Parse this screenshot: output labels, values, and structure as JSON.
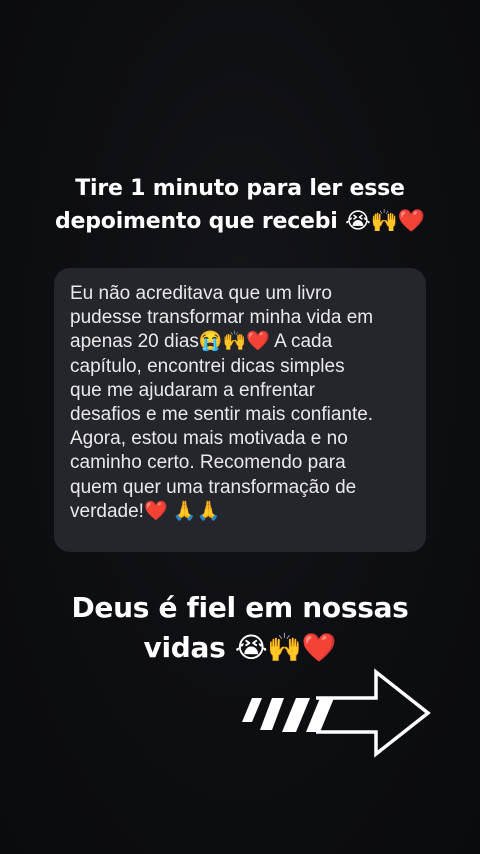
{
  "headline": {
    "line1": "Tire 1 minuto para ler esse",
    "line2": "depoimento que recebi 😭🙌❤️"
  },
  "testimonial": {
    "lines": [
      "Eu não acreditava que um livro",
      "pudesse transformar minha vida em",
      "apenas 20 dias😭🙌❤️  A cada",
      "capítulo, encontrei dicas simples",
      "que me ajudaram a enfrentar",
      "desafios e me sentir mais confiante.",
      "Agora, estou mais motivada e no",
      "caminho certo. Recomendo para",
      "quem quer uma transformação de",
      "verdade!❤️ 🙏🙏"
    ]
  },
  "footer": {
    "line1": "Deus é fiel em nossas",
    "line2": "vidas 😭🙌❤️"
  },
  "decorations": {
    "arrow_icon": "right-arrow-with-speed-stripes",
    "arrow_color": "#ffffff",
    "background_color": "#0d0e12",
    "bubble_color": "#25262b"
  }
}
